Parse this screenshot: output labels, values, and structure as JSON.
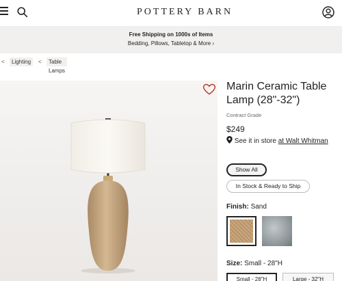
{
  "header": {
    "logo": "POTTERY BARN",
    "icons": [
      "menu-icon",
      "search-icon",
      "account-icon"
    ]
  },
  "promo": {
    "title": "Free Shipping on 1000s of Items",
    "subtitle": "Bedding, Pillows, Tabletop & More ›"
  },
  "breadcrumb": {
    "separator": "<",
    "items": [
      {
        "label": "Lighting"
      },
      {
        "label": "Table Lamps"
      }
    ]
  },
  "product": {
    "title": "Marin Ceramic Table Lamp (28\"-32\")",
    "grade": "Contract Grade",
    "price": "$249",
    "store_prefix": "See it in store",
    "store_link": "at Walt Whitman",
    "filters": [
      {
        "label": "Show All",
        "active": true
      },
      {
        "label": "In Stock & Ready to Ship",
        "active": false
      }
    ],
    "finish": {
      "label": "Finish:",
      "value": "Sand",
      "swatches": [
        {
          "name": "Sand",
          "color": "#c9a77f",
          "selected": true
        },
        {
          "name": "Gray",
          "color": "#9ca3a6",
          "selected": false
        }
      ]
    },
    "size": {
      "label": "Size:",
      "value": "Small - 28\"H",
      "options": [
        {
          "label": "Small - 28\"H",
          "active": true
        },
        {
          "label": "Large - 32\"H",
          "active": false
        }
      ]
    }
  },
  "colors": {
    "heart": "#c0392b",
    "promo_bg": "#f2f0ee"
  }
}
